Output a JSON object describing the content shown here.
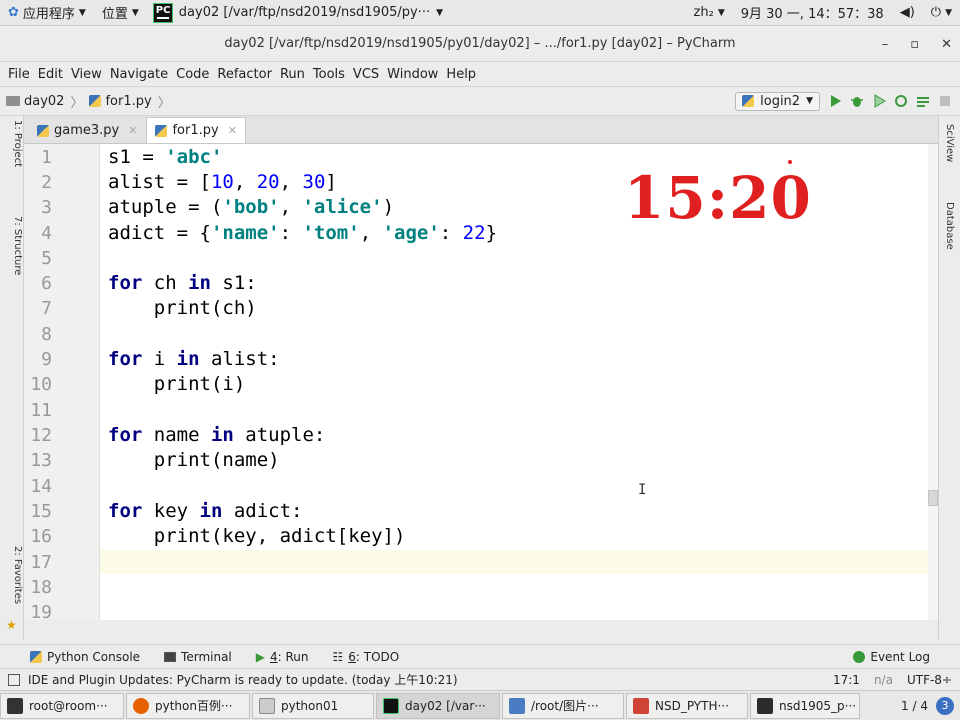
{
  "gnome_bar": {
    "apps_menu": "应用程序",
    "places_menu": "位置",
    "active_window": "day02 [/var/ftp/nsd2019/nsd1905/py···",
    "input_method": "zh₂",
    "clock": "9月 30 一, 14：57：38"
  },
  "window": {
    "title": "day02 [/var/ftp/nsd2019/nsd1905/py01/day02] – .../for1.py [day02] – PyCharm"
  },
  "menu": {
    "items": [
      "File",
      "Edit",
      "View",
      "Navigate",
      "Code",
      "Refactor",
      "Run",
      "Tools",
      "VCS",
      "Window",
      "Help"
    ]
  },
  "nav": {
    "project": "day02",
    "file": "for1.py",
    "run_config": "login2"
  },
  "tabs": [
    {
      "label": "game3.py",
      "active": false
    },
    {
      "label": "for1.py",
      "active": true
    }
  ],
  "editor": {
    "line_numbers": [
      "1",
      "2",
      "3",
      "4",
      "5",
      "6",
      "7",
      "8",
      "9",
      "10",
      "11",
      "12",
      "13",
      "14",
      "15",
      "16",
      "17",
      "18",
      "19"
    ],
    "current_line": 17,
    "overlay_time": "15:20"
  },
  "side_left": {
    "project_label": "1: Project",
    "structure_label": "7: Structure",
    "favorites_label": "2: Favorites"
  },
  "side_right": {
    "scview_label": "SciView",
    "database_label": "Database"
  },
  "tool_windows": {
    "python_console": "Python Console",
    "terminal": "Terminal",
    "run_num": "4",
    "run": ": Run",
    "todo_num": "6",
    "todo": ": TODO",
    "event_log": "Event Log"
  },
  "status": {
    "message": "IDE and Plugin Updates: PyCharm is ready to update. (today 上午10:21)",
    "position": "17:1",
    "line_sep": "n/a",
    "encoding": "UTF-8÷"
  },
  "taskbar": {
    "items": [
      "root@room···",
      "python百例···",
      "python01",
      "day02 [/var···",
      "/root/图片···",
      "NSD_PYTH···",
      "nsd1905_p···"
    ],
    "workspace": "1 / 4",
    "badge": "3"
  },
  "colors": {
    "keyword": "#000080",
    "string": "#008080",
    "number": "#0000ff",
    "overlay": "#e02020",
    "current_line": "#fbfbe6"
  }
}
